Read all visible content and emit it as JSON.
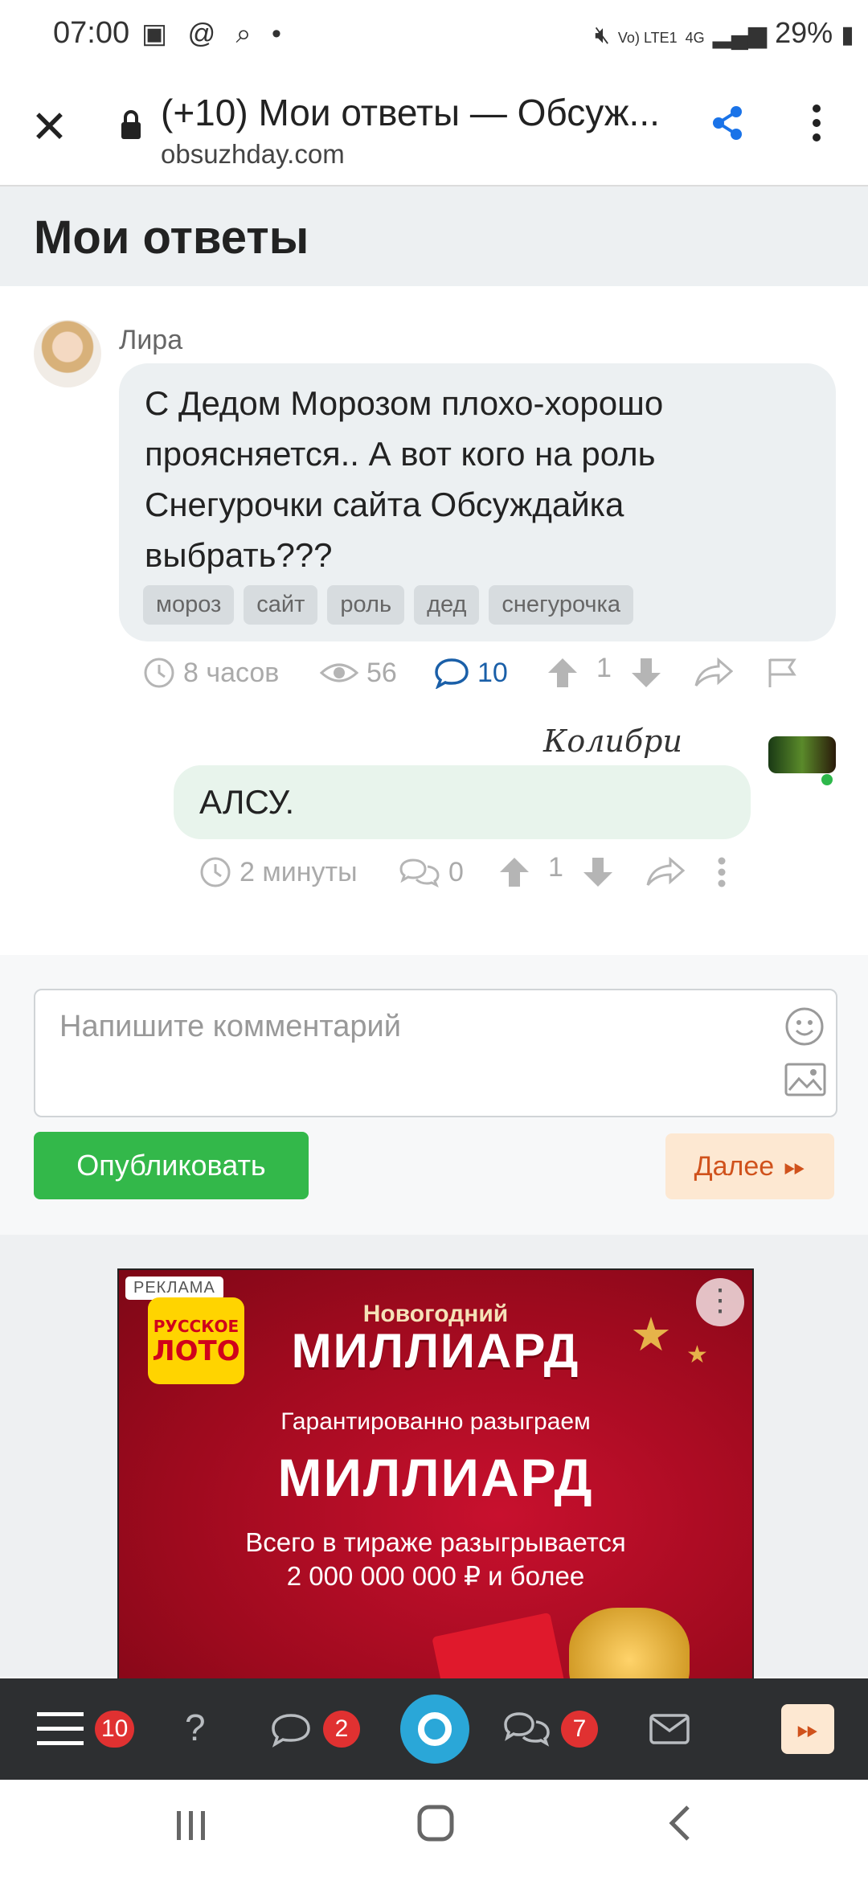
{
  "status_bar": {
    "time": "07:00",
    "battery": "29%",
    "icons": [
      "image-icon",
      "at-icon",
      "search-icon",
      "dot-icon",
      "mute-icon",
      "volte-icon",
      "4g-icon",
      "signal-icon",
      "battery-icon"
    ]
  },
  "browser": {
    "title": "(+10) Мои ответы — Обсуж...",
    "url": "obsuzhday.com"
  },
  "page": {
    "title": "Мои ответы"
  },
  "post": {
    "author": "Лира",
    "text": "С Дедом Морозом плохо-хорошо проясняется.. А вот кого на роль Снегурочки сайта Обсуждайка выбрать???",
    "tags": [
      "мороз",
      "сайт",
      "роль",
      "дед",
      "снегурочка"
    ],
    "time": "8 часов",
    "views": "56",
    "comments": "10",
    "votes": "1"
  },
  "reply": {
    "author": "Колибри",
    "text": "АЛСУ.",
    "time": "2 минуты",
    "comments": "0",
    "votes": "1"
  },
  "comment_form": {
    "placeholder": "Напишите комментарий",
    "publish_label": "Опубликовать",
    "next_label": "Далее"
  },
  "ad": {
    "label": "РЕКЛАМА",
    "logo_line1": "РУССКОЕ",
    "logo_line2": "ЛОТО",
    "subtitle": "Новогодний",
    "title": "МИЛЛИАРД",
    "line1": "Гарантированно разыграем",
    "big": "МИЛЛИАРД",
    "line2a": "Всего в тираже разыгрывается",
    "line2b": "2 000 000 000 ₽ и более"
  },
  "bottom_nav": {
    "menu_badge": "10",
    "comments_badge": "2",
    "discussions_badge": "7"
  },
  "colors": {
    "accent_blue": "#1a5fa8",
    "publish_green": "#33b84a",
    "next_orange": "#d0521c",
    "badge_red": "#e03131"
  }
}
